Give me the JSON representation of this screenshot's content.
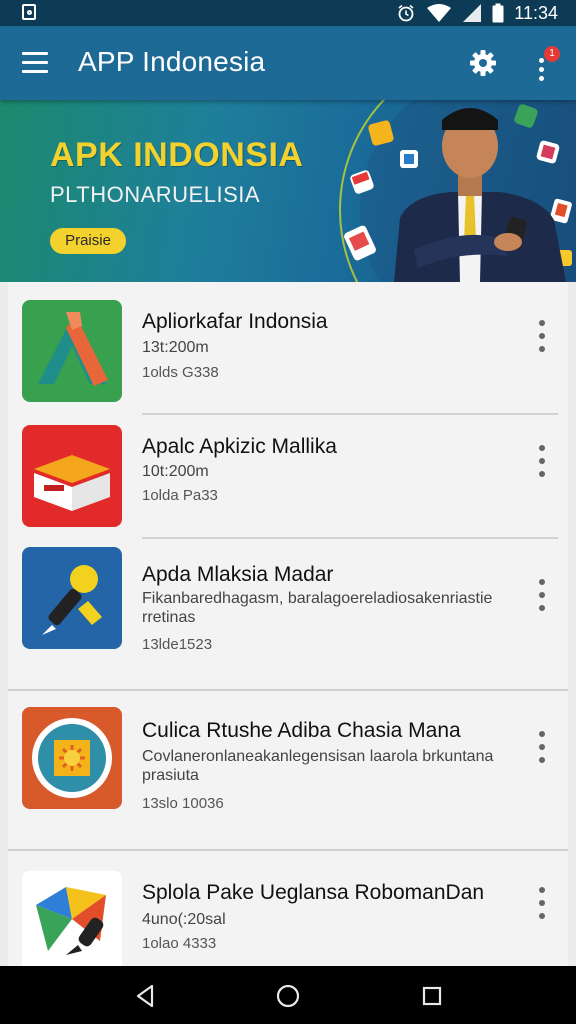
{
  "status_bar": {
    "time": "11:34"
  },
  "app_bar": {
    "title": "APP Indonesia",
    "notification_count": "1"
  },
  "banner": {
    "title": "APK INDONSIA",
    "subtitle": "PLTHONARUELISIA",
    "button_label": "Praisie"
  },
  "apps": [
    {
      "title": "Apliorkafar Indonsia",
      "subtitle": "13t:200m",
      "meta": "1olds G338"
    },
    {
      "title": "Apalc Apkizic Mallika",
      "subtitle": "10t:200m",
      "meta": "1olda Pa33"
    },
    {
      "title": "Apda Mlaksia Madar",
      "subtitle": "Fikanbaredhagasm, baralagoereladiosakenriastie rretinas",
      "meta": "13lde1523"
    },
    {
      "title": "Culica Rtushe Adiba Chasia Mana",
      "subtitle": "Covlaneronlaneakanlegensisan laarola brkuntana prasiuta",
      "meta": "13slo 10036"
    },
    {
      "title": "Splola Pake Ueglansa RobomanDan",
      "subtitle": "4uno(:20sal",
      "meta": "1olao 4333"
    }
  ],
  "icons": {
    "status_left": "gallery-icon",
    "status": [
      "alarm-icon",
      "wifi-icon",
      "signal-icon",
      "battery-icon"
    ],
    "app_bar": [
      "menu-icon",
      "settings-icon",
      "overflow-icon"
    ],
    "nav": [
      "back-icon",
      "home-icon",
      "recents-icon"
    ]
  },
  "colors": {
    "status_bar": "#0d3a55",
    "app_bar": "#1d6a96",
    "banner_accent": "#f4d22d",
    "badge": "#e53935"
  }
}
